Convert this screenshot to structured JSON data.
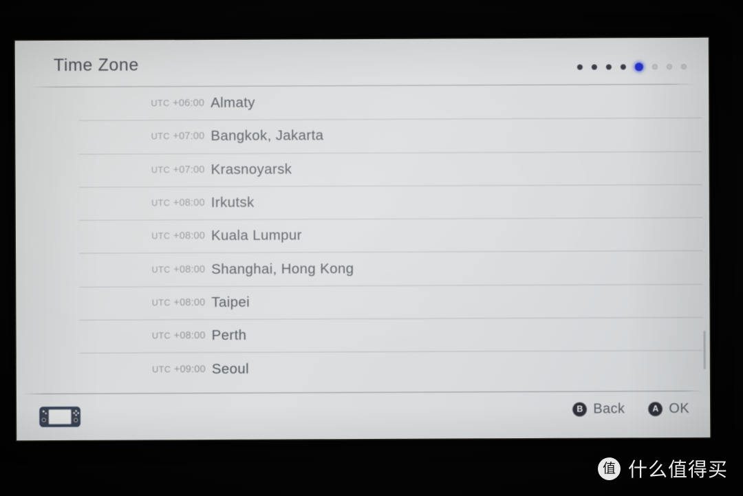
{
  "header": {
    "title": "Time Zone",
    "page_dots": [
      {
        "state": "filled"
      },
      {
        "state": "filled"
      },
      {
        "state": "filled"
      },
      {
        "state": "filled"
      },
      {
        "state": "active"
      },
      {
        "state": "dim"
      },
      {
        "state": "dim"
      },
      {
        "state": "dim"
      }
    ],
    "active_page": 5,
    "total_pages": 8,
    "accent_color": "#1f30e8"
  },
  "list": {
    "rows": [
      {
        "utc_abbr": "UTC",
        "utc_offset": "+06:00",
        "city": "Almaty"
      },
      {
        "utc_abbr": "UTC",
        "utc_offset": "+07:00",
        "city": "Bangkok, Jakarta"
      },
      {
        "utc_abbr": "UTC",
        "utc_offset": "+07:00",
        "city": "Krasnoyarsk"
      },
      {
        "utc_abbr": "UTC",
        "utc_offset": "+08:00",
        "city": "Irkutsk"
      },
      {
        "utc_abbr": "UTC",
        "utc_offset": "+08:00",
        "city": "Kuala Lumpur"
      },
      {
        "utc_abbr": "UTC",
        "utc_offset": "+08:00",
        "city": "Shanghai, Hong Kong"
      },
      {
        "utc_abbr": "UTC",
        "utc_offset": "+08:00",
        "city": "Taipei"
      },
      {
        "utc_abbr": "UTC",
        "utc_offset": "+08:00",
        "city": "Perth"
      },
      {
        "utc_abbr": "UTC",
        "utc_offset": "+09:00",
        "city": "Seoul"
      }
    ]
  },
  "footer": {
    "mode_icon": "nintendo-switch-handheld-icon",
    "actions": [
      {
        "button": "B",
        "label": "Back"
      },
      {
        "button": "A",
        "label": "OK"
      }
    ]
  },
  "watermark": {
    "badge": "值",
    "text": "什么值得买"
  }
}
